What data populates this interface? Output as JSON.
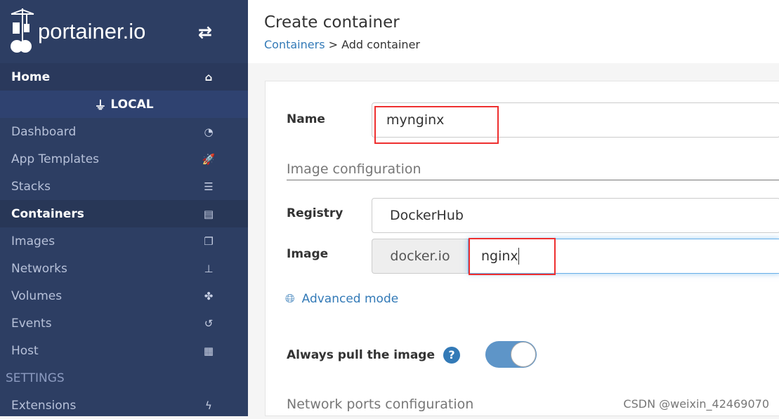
{
  "sidebar": {
    "logo": "portainer.io",
    "home": "Home",
    "endpoint": "LOCAL",
    "items": [
      {
        "label": "Dashboard",
        "icon": "tachometer-icon",
        "g": "◔"
      },
      {
        "label": "App Templates",
        "icon": "rocket-icon",
        "g": "🚀"
      },
      {
        "label": "Stacks",
        "icon": "th-list-icon",
        "g": "☰"
      },
      {
        "label": "Containers",
        "icon": "server-icon",
        "g": "▤"
      },
      {
        "label": "Images",
        "icon": "clone-icon",
        "g": "❐"
      },
      {
        "label": "Networks",
        "icon": "sitemap-icon",
        "g": "⊥"
      },
      {
        "label": "Volumes",
        "icon": "cubes-icon",
        "g": "✤"
      },
      {
        "label": "Events",
        "icon": "history-icon",
        "g": "↺"
      },
      {
        "label": "Host",
        "icon": "th-icon",
        "g": "▦"
      }
    ],
    "settings": "SETTINGS",
    "extensions": "Extensions"
  },
  "header": {
    "title": "Create container",
    "crumb_link": "Containers",
    "crumb_rest": " > Add container"
  },
  "form": {
    "name_label": "Name",
    "name_value": "mynginx",
    "image_section": "Image configuration",
    "registry_label": "Registry",
    "registry_value": "DockerHub",
    "image_label": "Image",
    "image_prefix": "docker.io",
    "image_value": "nginx",
    "advanced": "Advanced mode",
    "pull_label": "Always pull the image",
    "pull_enabled": true,
    "ports_section": "Network ports configuration"
  },
  "watermark": "CSDN @weixin_42469070",
  "colors": {
    "sidebar": "#2d3e63",
    "accent": "#337ab7",
    "highlight": "#ee2f2f"
  }
}
